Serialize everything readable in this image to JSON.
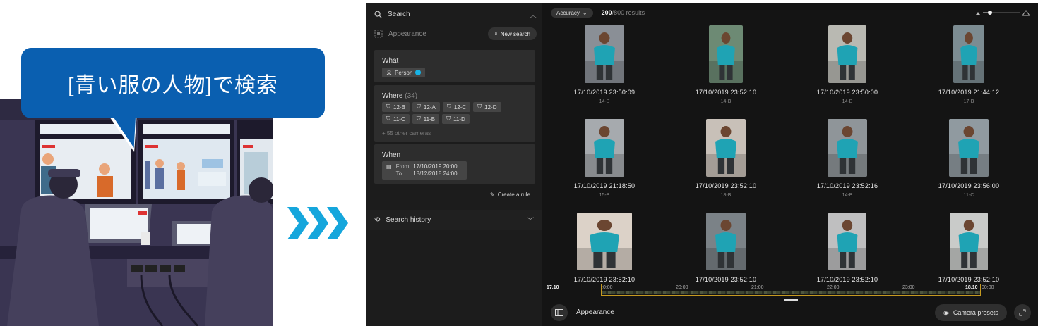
{
  "bubble": {
    "text": "[青い服の人物]で検索"
  },
  "sidebar": {
    "search_label": "Search",
    "appearance_label": "Appearance",
    "new_search_label": "New search",
    "what": {
      "title": "What",
      "chip_label": "Person",
      "chip_color": "#17b3e6"
    },
    "where": {
      "title": "Where",
      "count": "(34)",
      "cameras": [
        "12-B",
        "12-A",
        "12-C",
        "12-D",
        "11-C",
        "11-B",
        "11-D"
      ],
      "more": "55 other cameras"
    },
    "when": {
      "title": "When",
      "from_label": "From",
      "to_label": "To",
      "from_value": "17/10/2019 20:00",
      "to_value": "18/12/2018 24:00"
    },
    "create_rule_label": "Create a rule",
    "history_label": "Search history"
  },
  "main": {
    "accuracy_label": "Accuracy",
    "results_count": "200",
    "results_total": "/800 results",
    "results": [
      {
        "timestamp": "17/10/2019 23:50:09",
        "camera": "14-B"
      },
      {
        "timestamp": "17/10/2019 23:52:10",
        "camera": "14-B"
      },
      {
        "timestamp": "17/10/2019 23:50:00",
        "camera": "14-B"
      },
      {
        "timestamp": "17/10/2019 21:44:12",
        "camera": "17-B"
      },
      {
        "timestamp": "17/10/2019 21:18:50",
        "camera": "15-B"
      },
      {
        "timestamp": "17/10/2019 23:52:10",
        "camera": "18-B"
      },
      {
        "timestamp": "17/10/2019 23:52:16",
        "camera": "14-B"
      },
      {
        "timestamp": "17/10/2019 23:56:00",
        "camera": "11-C"
      },
      {
        "timestamp": "17/10/2019 23:52:10",
        "camera": ""
      },
      {
        "timestamp": "17/10/2019 23:52:10",
        "camera": ""
      },
      {
        "timestamp": "17/10/2019 23:52:10",
        "camera": ""
      },
      {
        "timestamp": "17/10/2019 23:52:10",
        "camera": ""
      }
    ],
    "timeline": {
      "start_label": "17.10",
      "ticks": [
        ":0:00",
        "20:00",
        "21:00",
        "22:00",
        "23:00"
      ],
      "end_label": "18.10",
      "after_label": "00:00",
      "accent": "#c59a20"
    },
    "bottom": {
      "label": "Appearance",
      "presets_label": "Camera presets"
    }
  }
}
